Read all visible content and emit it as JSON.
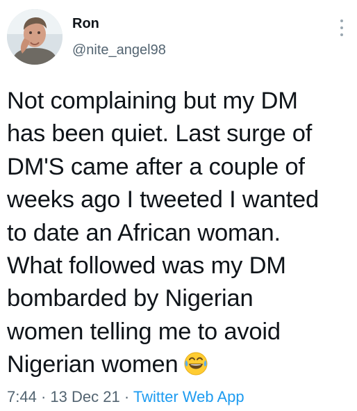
{
  "author": {
    "name": "Ron",
    "handle": "@nite_angel98"
  },
  "tweet": {
    "lines": [
      "Not complaining but my DM",
      "has been quiet. Last surge of",
      "DM'S came after a couple of",
      "weeks ago I tweeted I wanted",
      "to date an African woman.",
      "What followed was my DM",
      "bombarded by Nigerian",
      "women telling me to avoid",
      "Nigerian women"
    ],
    "emoji": "tears-of-joy-emoji"
  },
  "meta": {
    "time": "7:44",
    "separator": "·",
    "date": "13 Dec 21",
    "source": "Twitter Web App"
  },
  "colors": {
    "text": "#0f1419",
    "secondary": "#536471",
    "link": "#1d9bf0"
  }
}
